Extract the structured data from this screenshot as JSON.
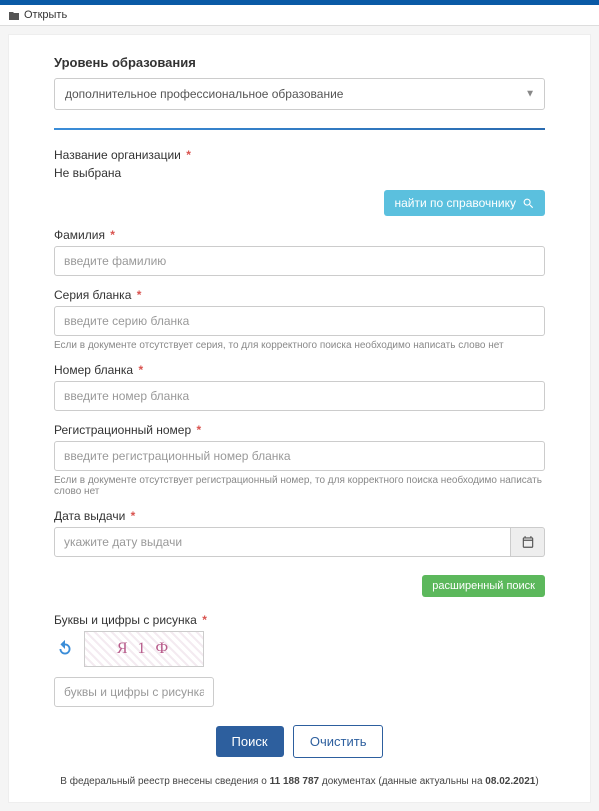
{
  "topbar": {
    "open_label": "Открыть"
  },
  "form": {
    "education_level_title": "Уровень образования",
    "education_level_value": "дополнительное профессиональное образование",
    "org_label": "Название организации",
    "org_none": "Не выбрана",
    "find_ref_label": "найти по справочнику",
    "surname_label": "Фамилия",
    "surname_placeholder": "введите фамилию",
    "blank_series_label": "Серия бланка",
    "blank_series_placeholder": "введите серию бланка",
    "blank_series_help": "Если в документе отсутствует серия, то для корректного поиска необходимо написать слово нет",
    "blank_number_label": "Номер бланка",
    "blank_number_placeholder": "введите номер бланка",
    "reg_number_label": "Регистрационный номер",
    "reg_number_placeholder": "введите регистрационный номер бланка",
    "reg_number_help": "Если в документе отсутствует регистрационный номер, то для корректного поиска необходимо написать слово нет",
    "issue_date_label": "Дата выдачи",
    "issue_date_placeholder": "укажите дату выдачи",
    "advanced_label": "расширенный поиск",
    "captcha_label": "Буквы и цифры с рисунка",
    "captcha_text": "Я 1 Ф",
    "captcha_placeholder": "буквы и цифры с рисунка",
    "search_label": "Поиск",
    "clear_label": "Очистить"
  },
  "footer": {
    "prefix": "В федеральный реестр внесены сведения о ",
    "count": "11 188 787",
    "mid": " документах (данные актуальны на ",
    "date": "08.02.2021",
    "suffix": ")"
  }
}
